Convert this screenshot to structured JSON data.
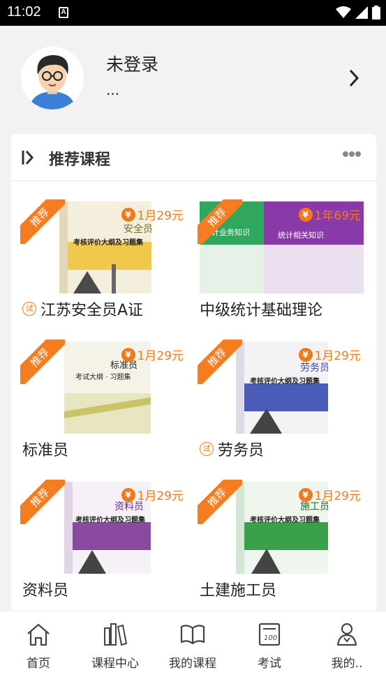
{
  "status_bar": {
    "time": "11:02",
    "notification_icon": "A"
  },
  "profile": {
    "name": "未登录",
    "subtitle": "..."
  },
  "section": {
    "title": "推荐课程"
  },
  "badge_label": "推荐",
  "trial_label": "试",
  "colors": {
    "accent": "#f57c1f",
    "price": "#f07a1a"
  },
  "courses": [
    {
      "name": "江苏安全员A证",
      "price": "1月29元",
      "trial": true
    },
    {
      "name": "中级统计基础理论",
      "price": "1年69元",
      "trial": false
    },
    {
      "name": "标准员",
      "price": "1月29元",
      "trial": false
    },
    {
      "name": "劳务员",
      "price": "1月29元",
      "trial": true
    },
    {
      "name": "资料员",
      "price": "1月29元",
      "trial": false
    },
    {
      "name": "土建施工员",
      "price": "1月29元",
      "trial": false
    }
  ],
  "covers": [
    {
      "title": "安全员",
      "subtitle": "考核评价大纲及习题集"
    },
    {
      "left_title": "统计业务知识",
      "right_title": "统计相关知识"
    },
    {
      "title": "标准员",
      "subtitle": "考试大纲 · 习题集"
    },
    {
      "title": "劳务员",
      "subtitle": "考核评价大纲及习题集"
    },
    {
      "title": "资料员",
      "subtitle": "考核评价大纲及习题集"
    },
    {
      "title": "施工员",
      "subtitle": "考核评价大纲及习题集"
    }
  ],
  "tabs": [
    {
      "label": "首页",
      "icon": "home-icon"
    },
    {
      "label": "课程中心",
      "icon": "books-icon"
    },
    {
      "label": "我的课程",
      "icon": "open-book-icon"
    },
    {
      "label": "考试",
      "icon": "exam-paper-icon"
    },
    {
      "label": "我的..",
      "icon": "user-icon"
    }
  ]
}
